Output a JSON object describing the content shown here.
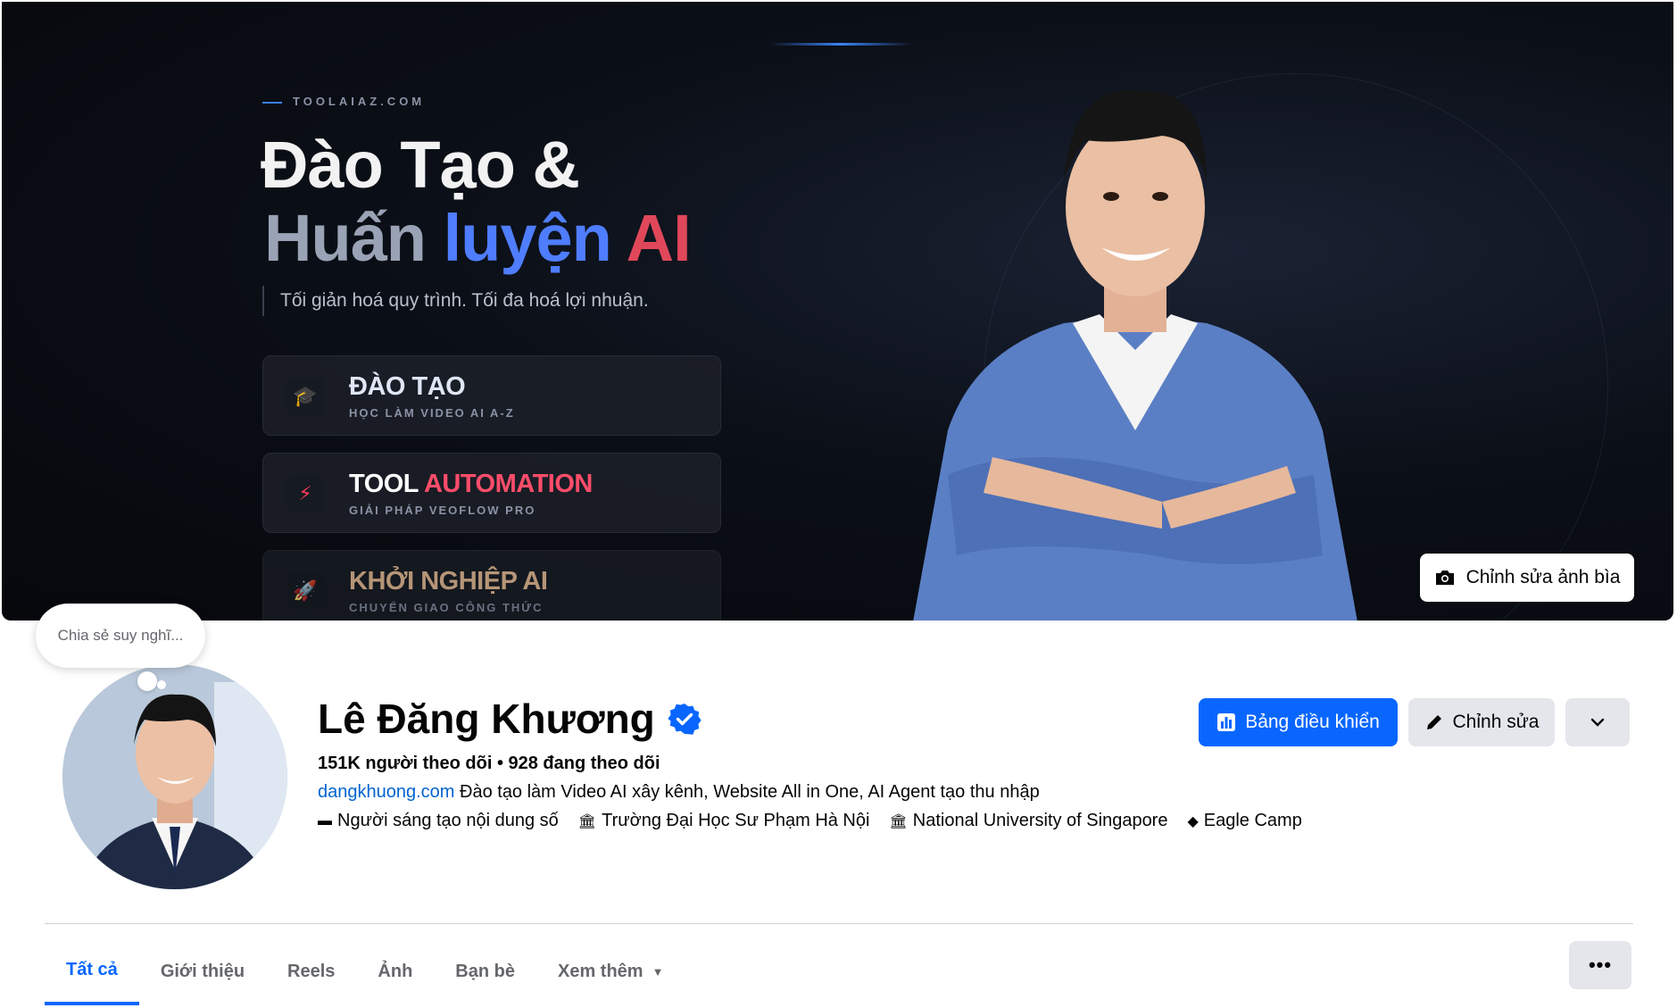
{
  "cover": {
    "site": "TOOLAIAZ.COM",
    "headline_line1": "Đào Tạo &",
    "headline_line2_part1": "Huấn",
    "headline_line2_part2": "luyện",
    "headline_line2_part3": "AI",
    "tagline": "Tối giản hoá quy trình. Tối đa hoá lợi nhuận.",
    "cards": [
      {
        "title": "ĐÀO TẠO",
        "subtitle": "HỌC LÀM VIDEO AI A-Z",
        "icon": "graduation-cap-icon"
      },
      {
        "title_a": "TOOL",
        "title_b": "AUTOMATION",
        "subtitle": "GIẢI PHÁP VEOFLOW PRO",
        "icon": "lightning-icon"
      },
      {
        "title": "KHỞI NGHIỆP AI",
        "subtitle": "CHUYỂN GIAO CÔNG THỨC",
        "icon": "rocket-icon"
      }
    ],
    "edit_label": "Chỉnh sửa ảnh bìa"
  },
  "thought_bubble": "Chia sẻ suy nghĩ...",
  "profile": {
    "name": "Lê Đăng Khương",
    "followers": "151K người theo dõi • 928 đang theo dõi",
    "bio_link": "dangkhuong.com",
    "bio_text": " Đào tạo làm Video AI xây kênh, Website All in One, AI Agent tạo thu nhập",
    "meta": [
      {
        "icon": "video-creator-icon",
        "glyph": "▬",
        "label": "Người sáng tạo nội dung số"
      },
      {
        "icon": "school-icon",
        "glyph": "🏛",
        "label": "Trường Đại Học Sư Phạm Hà Nội"
      },
      {
        "icon": "school-icon",
        "glyph": "🏛",
        "label": "National University of Singapore"
      },
      {
        "icon": "graduation-cap-icon",
        "glyph": "◆",
        "label": "Eagle Camp"
      }
    ]
  },
  "actions": {
    "dashboard": "Bảng điều khiển",
    "edit": "Chỉnh sửa",
    "more_glyph": "⌄"
  },
  "tabs": [
    "Tất cả",
    "Giới thiệu",
    "Reels",
    "Ảnh",
    "Bạn bè",
    "Xem thêm"
  ],
  "tab_menu": "•••",
  "colors": {
    "primary": "#0866ff",
    "link": "#0064d1",
    "secondary_bg": "#e4e6eb",
    "cover_bg": "#06080c"
  }
}
